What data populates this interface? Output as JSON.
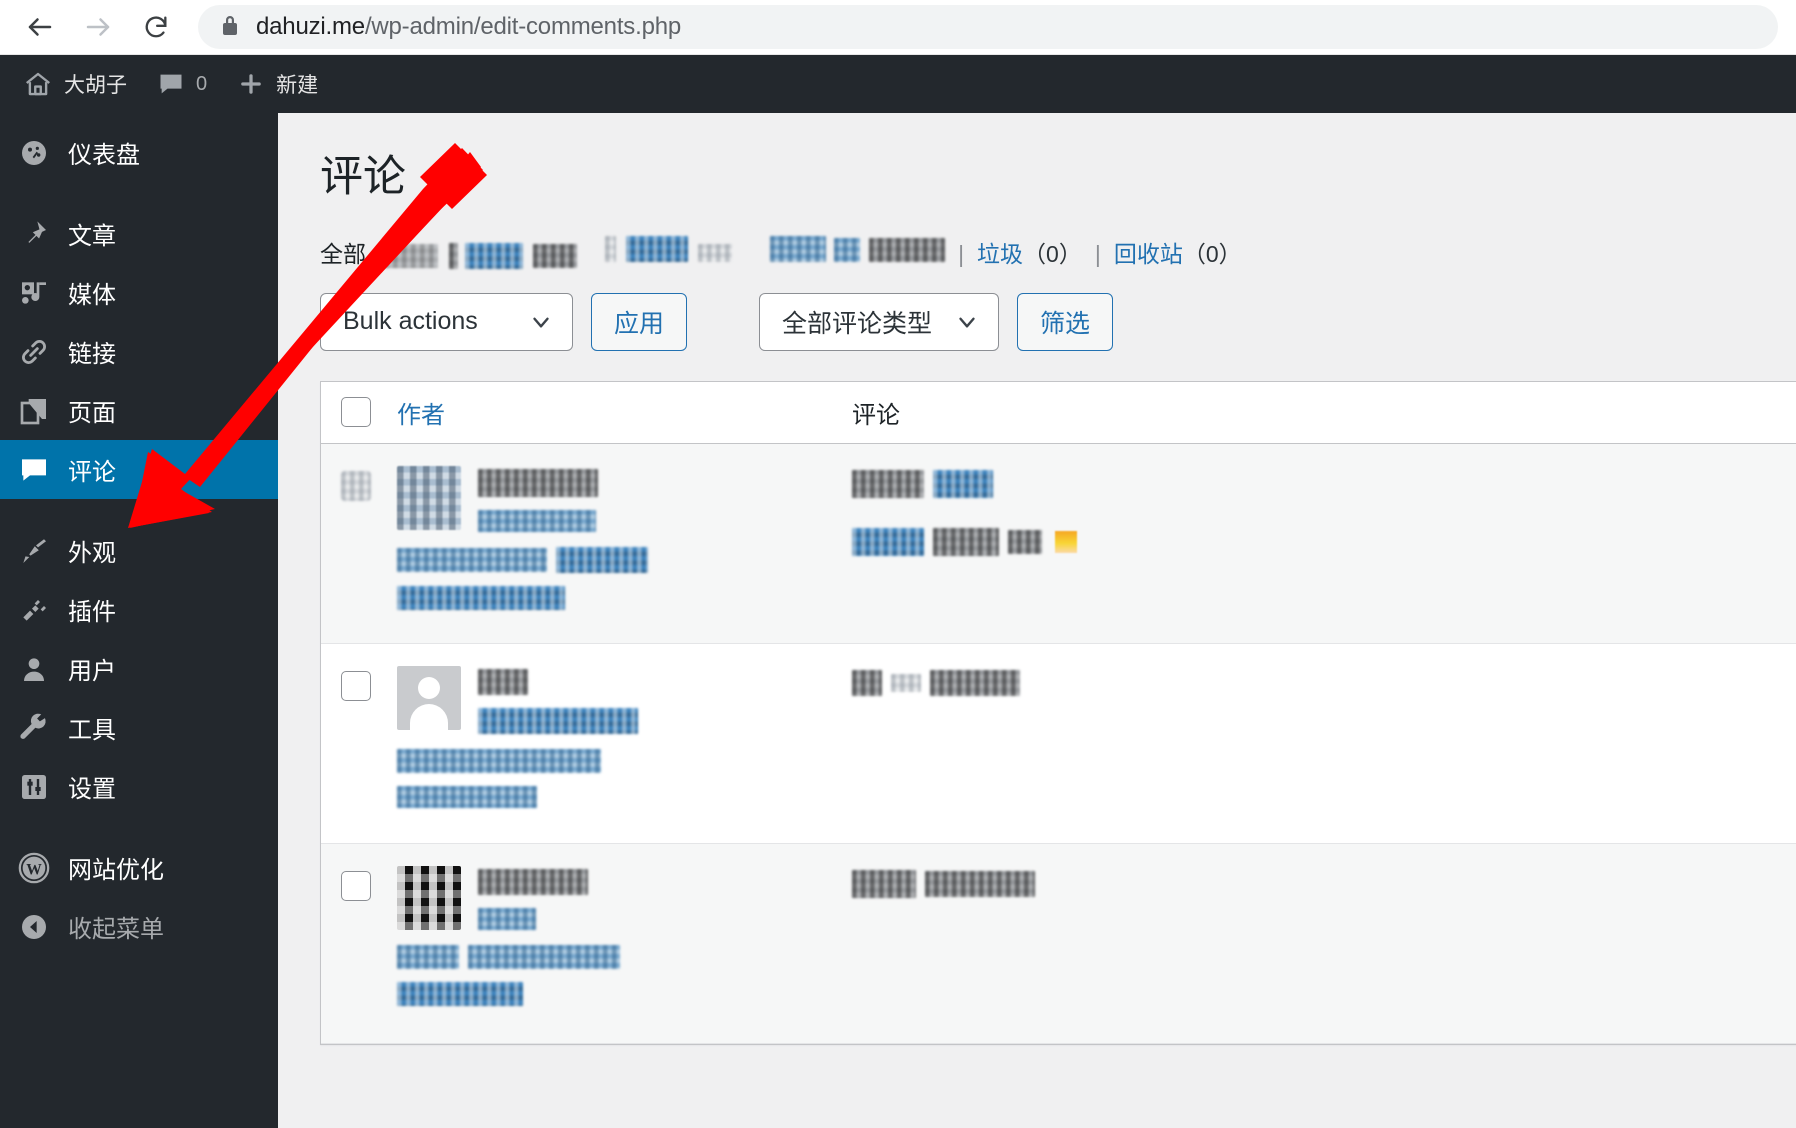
{
  "browser": {
    "back_icon": "back-arrow-icon",
    "forward_icon": "forward-arrow-icon",
    "reload_icon": "reload-icon",
    "lock_icon": "lock-icon",
    "url_host": "dahuzi.me",
    "url_path": "/wp-admin/edit-comments.php"
  },
  "adminbar": {
    "home_icon": "home-icon",
    "site_name": "大胡子",
    "comments_icon": "comment-bubble-icon",
    "comments_count": "0",
    "new_icon": "plus-icon",
    "new_label": "新建"
  },
  "sidebar": {
    "items": [
      {
        "label": "仪表盘",
        "icon": "dashboard-gauge-icon",
        "current": false
      },
      {
        "label": "文章",
        "icon": "pin-icon",
        "current": false
      },
      {
        "label": "媒体",
        "icon": "media-icon",
        "current": false
      },
      {
        "label": "链接",
        "icon": "link-chain-icon",
        "current": false
      },
      {
        "label": "页面",
        "icon": "pages-icon",
        "current": false
      },
      {
        "label": "评论",
        "icon": "comment-bubble-icon",
        "current": true
      },
      {
        "label": "外观",
        "icon": "paintbrush-icon",
        "current": false
      },
      {
        "label": "插件",
        "icon": "plug-icon",
        "current": false
      },
      {
        "label": "用户",
        "icon": "user-icon",
        "current": false
      },
      {
        "label": "工具",
        "icon": "wrench-icon",
        "current": false
      },
      {
        "label": "设置",
        "icon": "sliders-icon",
        "current": false
      },
      {
        "label": "网站优化",
        "icon": "wordpress-logo-icon",
        "current": false
      },
      {
        "label": "收起菜单",
        "icon": "collapse-arrow-icon",
        "current": false
      }
    ]
  },
  "main": {
    "page_title": "评论",
    "filters": {
      "all_label": "全部",
      "all_count_redacted": true,
      "middle_redacted_groups": 3,
      "trash_label": "垃圾",
      "trash_count": "（0）",
      "bin_label": "回收站",
      "bin_count": "（0）",
      "separator": "|"
    },
    "toolbar": {
      "bulk_actions_label": "Bulk actions",
      "apply_label": "应用",
      "comment_type_label": "全部评论类型",
      "filter_label": "筛选",
      "chevron_icon": "chevron-down-icon"
    },
    "table": {
      "headers": {
        "select_all": "select-all-checkbox",
        "author": "作者",
        "comment": "评论"
      },
      "rows": [
        {
          "avatar_kind": "photo",
          "author_redacted": true,
          "comment_redacted": true,
          "has_emoji": true,
          "alt": true
        },
        {
          "avatar_kind": "mystery",
          "author_redacted": true,
          "comment_redacted": true,
          "has_emoji": false,
          "alt": false
        },
        {
          "avatar_kind": "identicon",
          "author_redacted": true,
          "comment_redacted": true,
          "has_emoji": false,
          "alt": true
        }
      ]
    }
  },
  "annotation": {
    "arrow_color": "#FF0000",
    "arrow_points_to": "sidebar-item-评论"
  },
  "colors": {
    "sidebar_bg": "#23282d",
    "sidebar_current": "#0073aa",
    "content_bg": "#f0f0f1",
    "link_blue": "#2271b1",
    "arrow_red": "#FF0000"
  }
}
